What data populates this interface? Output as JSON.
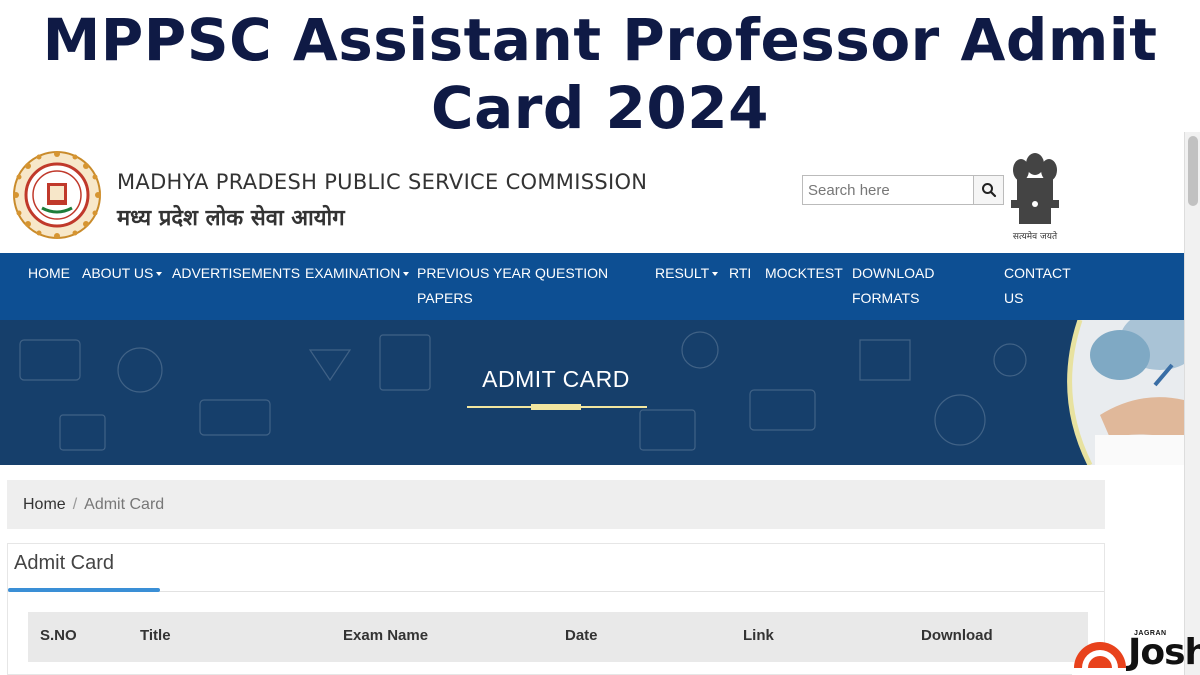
{
  "headline": {
    "line1": "MPPSC Assistant Professor Admit",
    "line2": "Card 2024"
  },
  "header": {
    "org_name_en": "MADHYA PRADESH PUBLIC SERVICE COMMISSION",
    "org_name_hi": "मध्य प्रदेश लोक सेवा आयोग",
    "emblem_motto": "सत्यमेव जयते",
    "left_logo_icon": "mppsc-seal-icon",
    "right_logo_icon": "national-emblem-icon"
  },
  "search": {
    "placeholder": "Search here",
    "button_icon": "search-icon"
  },
  "nav": {
    "items": [
      {
        "label": "HOME"
      },
      {
        "label": "ABOUT US"
      },
      {
        "label": "ADVERTISEMENTS"
      },
      {
        "label": "EXAMINATION"
      },
      {
        "label": "PREVIOUS YEAR QUESTION",
        "label2": "PAPERS"
      },
      {
        "label": "RESULT"
      },
      {
        "label": "RTI"
      },
      {
        "label": "MOCKTEST"
      },
      {
        "label": "DOWNLOAD",
        "label2": "FORMATS"
      },
      {
        "label": "CONTACT",
        "label2": "US"
      }
    ]
  },
  "banner": {
    "title": "ADMIT CARD"
  },
  "breadcrumb": {
    "home": "Home",
    "separator": "/",
    "current": "Admit Card"
  },
  "panel": {
    "title": "Admit Card"
  },
  "table": {
    "headers": [
      "S.NO",
      "Title",
      "Exam Name",
      "Date",
      "Link",
      "Download"
    ]
  },
  "watermark": {
    "small": "JAGRAN",
    "brand": "Josh"
  },
  "colors": {
    "headline": "#0f1a45",
    "navbar": "#0d4f93",
    "banner": "#163f6b",
    "accent_blue": "#3a8fd6",
    "underline": "#f2e6a0"
  }
}
